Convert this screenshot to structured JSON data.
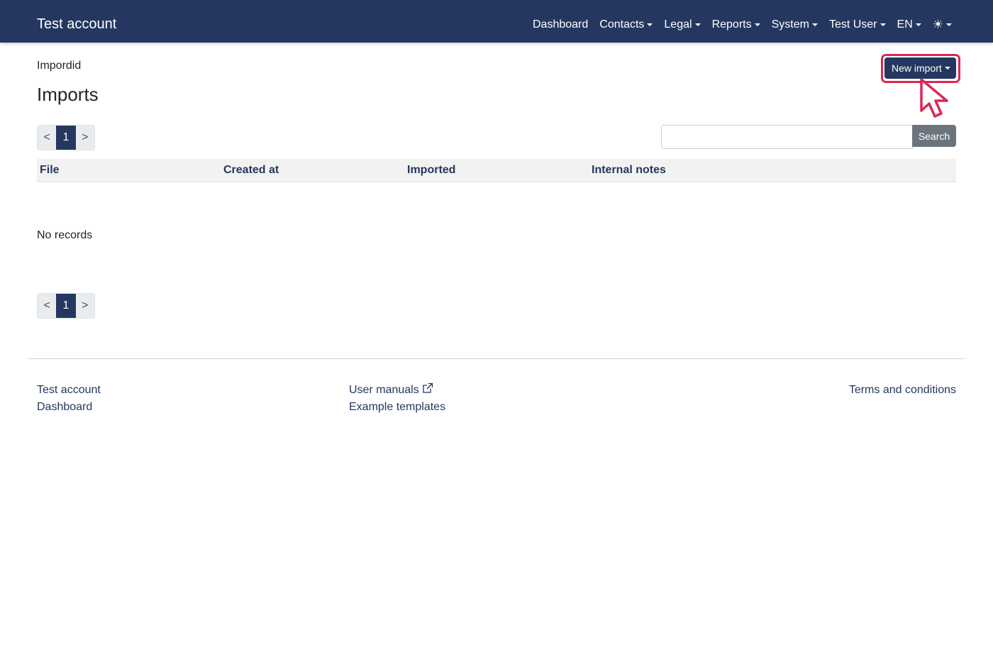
{
  "navbar": {
    "brand": "Test account",
    "items": [
      {
        "label": "Dashboard",
        "dropdown": false
      },
      {
        "label": "Contacts",
        "dropdown": true
      },
      {
        "label": "Legal",
        "dropdown": true
      },
      {
        "label": "Reports",
        "dropdown": true
      },
      {
        "label": "System",
        "dropdown": true
      },
      {
        "label": "Test User",
        "dropdown": true
      },
      {
        "label": "EN",
        "dropdown": true
      }
    ],
    "theme_icon": "sun-icon",
    "theme_glyph": "☀"
  },
  "page": {
    "breadcrumb": "Impordid",
    "title": "Imports",
    "new_import_label": "New import"
  },
  "pagination": {
    "prev": "<",
    "current": "1",
    "next": ">"
  },
  "search": {
    "value": "",
    "placeholder": "",
    "button_label": "Search"
  },
  "table": {
    "columns": [
      "File",
      "Created at",
      "Imported",
      "Internal notes"
    ],
    "rows": [],
    "empty_text": "No records"
  },
  "footer": {
    "col1": [
      "Test account",
      "Dashboard"
    ],
    "col2": [
      "User manuals",
      "Example templates"
    ],
    "col3": [
      "Terms and conditions"
    ]
  },
  "colors": {
    "primary": "#253760",
    "highlight": "#dc2853",
    "secondary": "#6c757d"
  }
}
